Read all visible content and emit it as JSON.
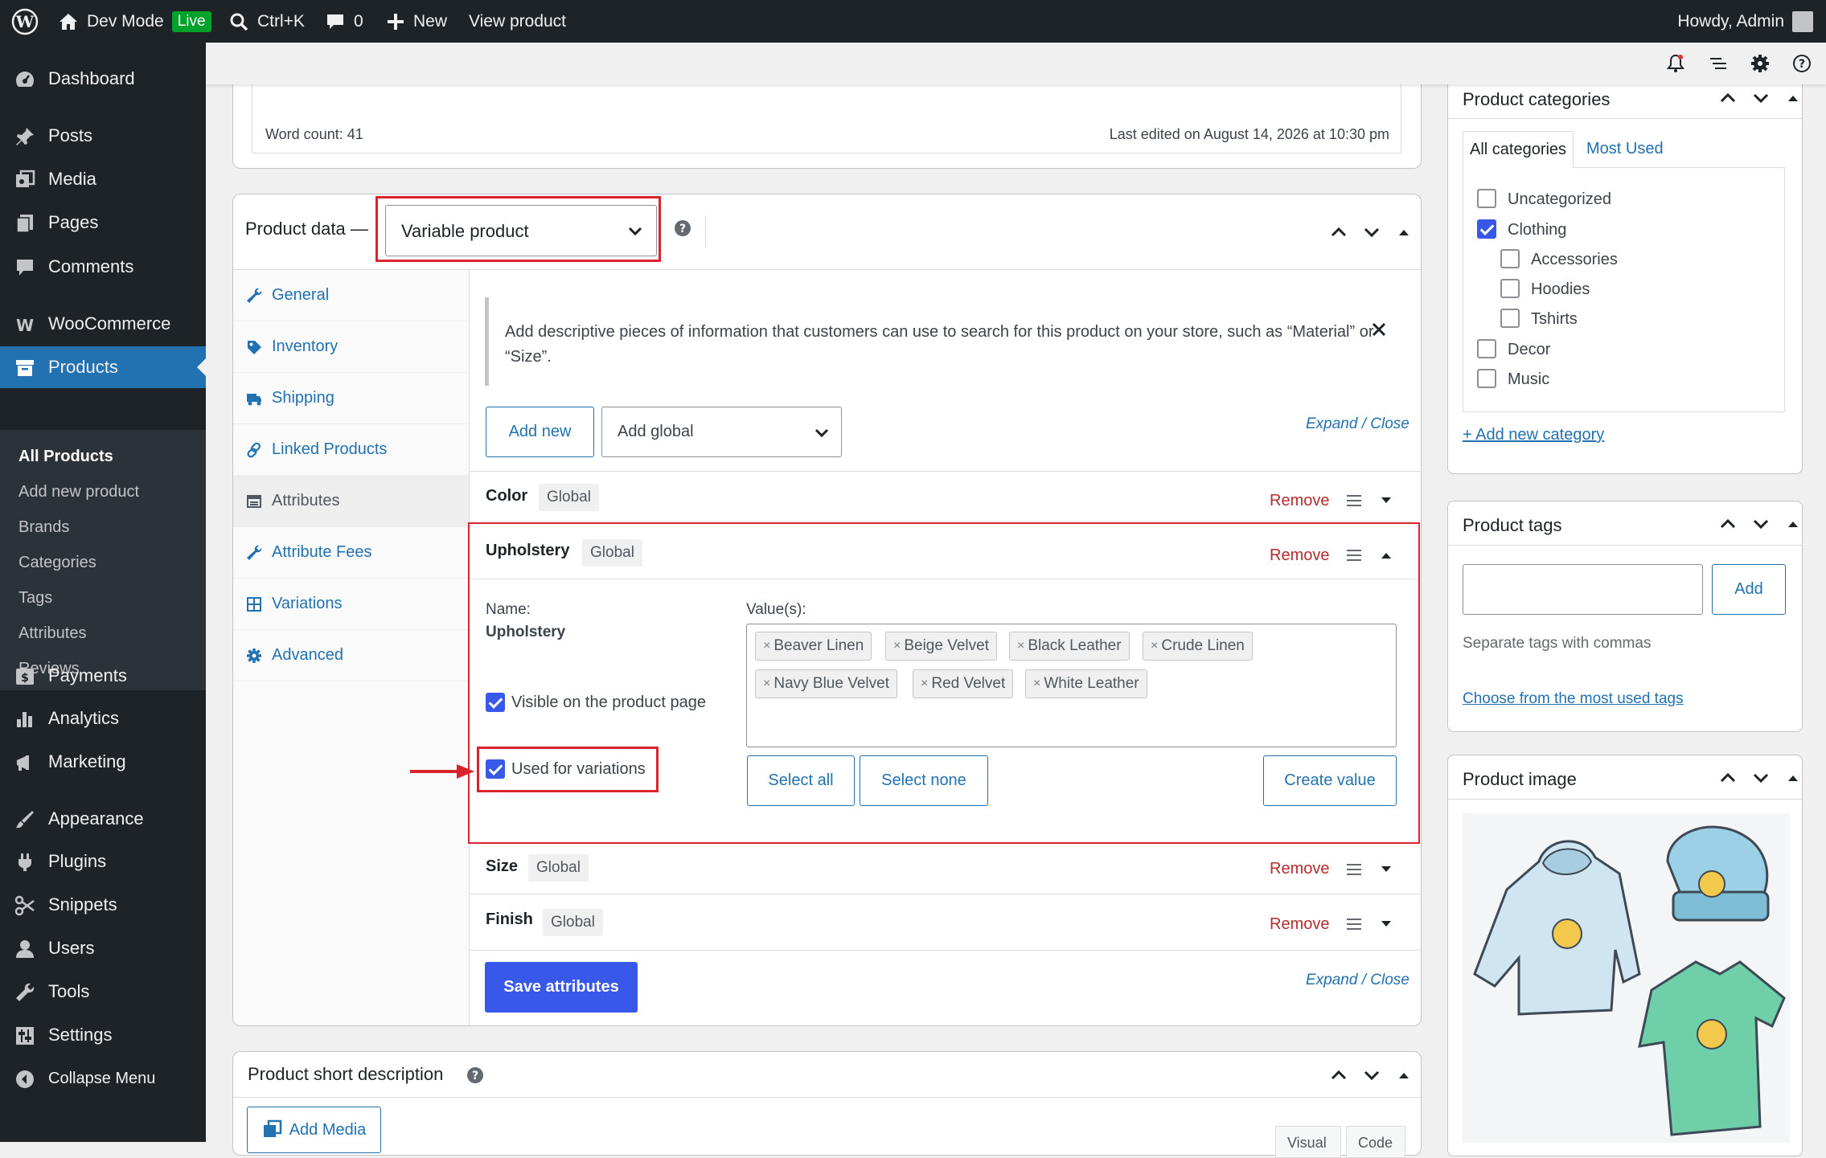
{
  "admin_bar": {
    "site_name": "Dev Mode",
    "live_badge": "Live",
    "search_shortcut": "Ctrl+K",
    "comments_count": "0",
    "new_label": "New",
    "view_product": "View product",
    "howdy": "Howdy, Admin"
  },
  "sidebar": {
    "items": [
      {
        "label": "Dashboard"
      },
      {
        "label": "Posts"
      },
      {
        "label": "Media"
      },
      {
        "label": "Pages"
      },
      {
        "label": "Comments"
      },
      {
        "label": "WooCommerce"
      },
      {
        "label": "Products"
      },
      {
        "label": "Payments"
      },
      {
        "label": "Analytics"
      },
      {
        "label": "Marketing"
      },
      {
        "label": "Appearance"
      },
      {
        "label": "Plugins"
      },
      {
        "label": "Snippets"
      },
      {
        "label": "Users"
      },
      {
        "label": "Tools"
      },
      {
        "label": "Settings"
      },
      {
        "label": "Collapse Menu"
      }
    ],
    "submenu": [
      "All Products",
      "Add new product",
      "Brands",
      "Categories",
      "Tags",
      "Attributes",
      "Reviews"
    ]
  },
  "editor": {
    "word_count": "Word count: 41",
    "last_edited": "Last edited on August 14, 2026 at 10:30 pm"
  },
  "product_data": {
    "label": "Product data —",
    "type_select": "Variable product",
    "tabs": [
      "General",
      "Inventory",
      "Shipping",
      "Linked Products",
      "Attributes",
      "Attribute Fees",
      "Variations",
      "Advanced"
    ],
    "notice": "Add descriptive pieces of information that customers can use to search for this product on your store, such as “Material” or “Size”.",
    "add_new": "Add new",
    "add_global": "Add global",
    "expand_close": "Expand / Close",
    "remove": "Remove",
    "global": "Global",
    "attributes": [
      {
        "name": "Color"
      },
      {
        "name": "Upholstery"
      },
      {
        "name": "Size"
      },
      {
        "name": "Finish"
      }
    ],
    "upholstery": {
      "name_label": "Name:",
      "name_value": "Upholstery",
      "values_label": "Value(s):",
      "values": [
        "Beaver Linen",
        "Beige Velvet",
        "Black Leather",
        "Crude Linen",
        "Navy Blue Velvet",
        "Red Velvet",
        "White Leather"
      ],
      "visible_label": "Visible on the product page",
      "visible_checked": true,
      "variations_label": "Used for variations",
      "variations_checked": true,
      "select_all": "Select all",
      "select_none": "Select none",
      "create_value": "Create value"
    },
    "save_attributes": "Save attributes"
  },
  "short_description": {
    "title": "Product short description",
    "add_media": "Add Media",
    "tab_visual": "Visual",
    "tab_code": "Code"
  },
  "categories": {
    "title": "Product categories",
    "tab_all": "All categories",
    "tab_used": "Most Used",
    "items": [
      {
        "label": "Uncategorized",
        "checked": false,
        "level": 0
      },
      {
        "label": "Clothing",
        "checked": true,
        "level": 0
      },
      {
        "label": "Accessories",
        "checked": false,
        "level": 1
      },
      {
        "label": "Hoodies",
        "checked": false,
        "level": 1
      },
      {
        "label": "Tshirts",
        "checked": false,
        "level": 1
      },
      {
        "label": "Decor",
        "checked": false,
        "level": 0
      },
      {
        "label": "Music",
        "checked": false,
        "level": 0
      }
    ],
    "add_new": "+ Add new category"
  },
  "tags": {
    "title": "Product tags",
    "add_button": "Add",
    "hint": "Separate tags with commas",
    "choose_link": "Choose from the most used tags"
  },
  "product_image": {
    "title": "Product image"
  },
  "colors": {
    "admin_dark": "#1d2327",
    "accent_blue": "#2271b1",
    "primary_button": "#3858e9",
    "highlight_red": "#d9232d",
    "remove_red": "#b32d2e"
  }
}
